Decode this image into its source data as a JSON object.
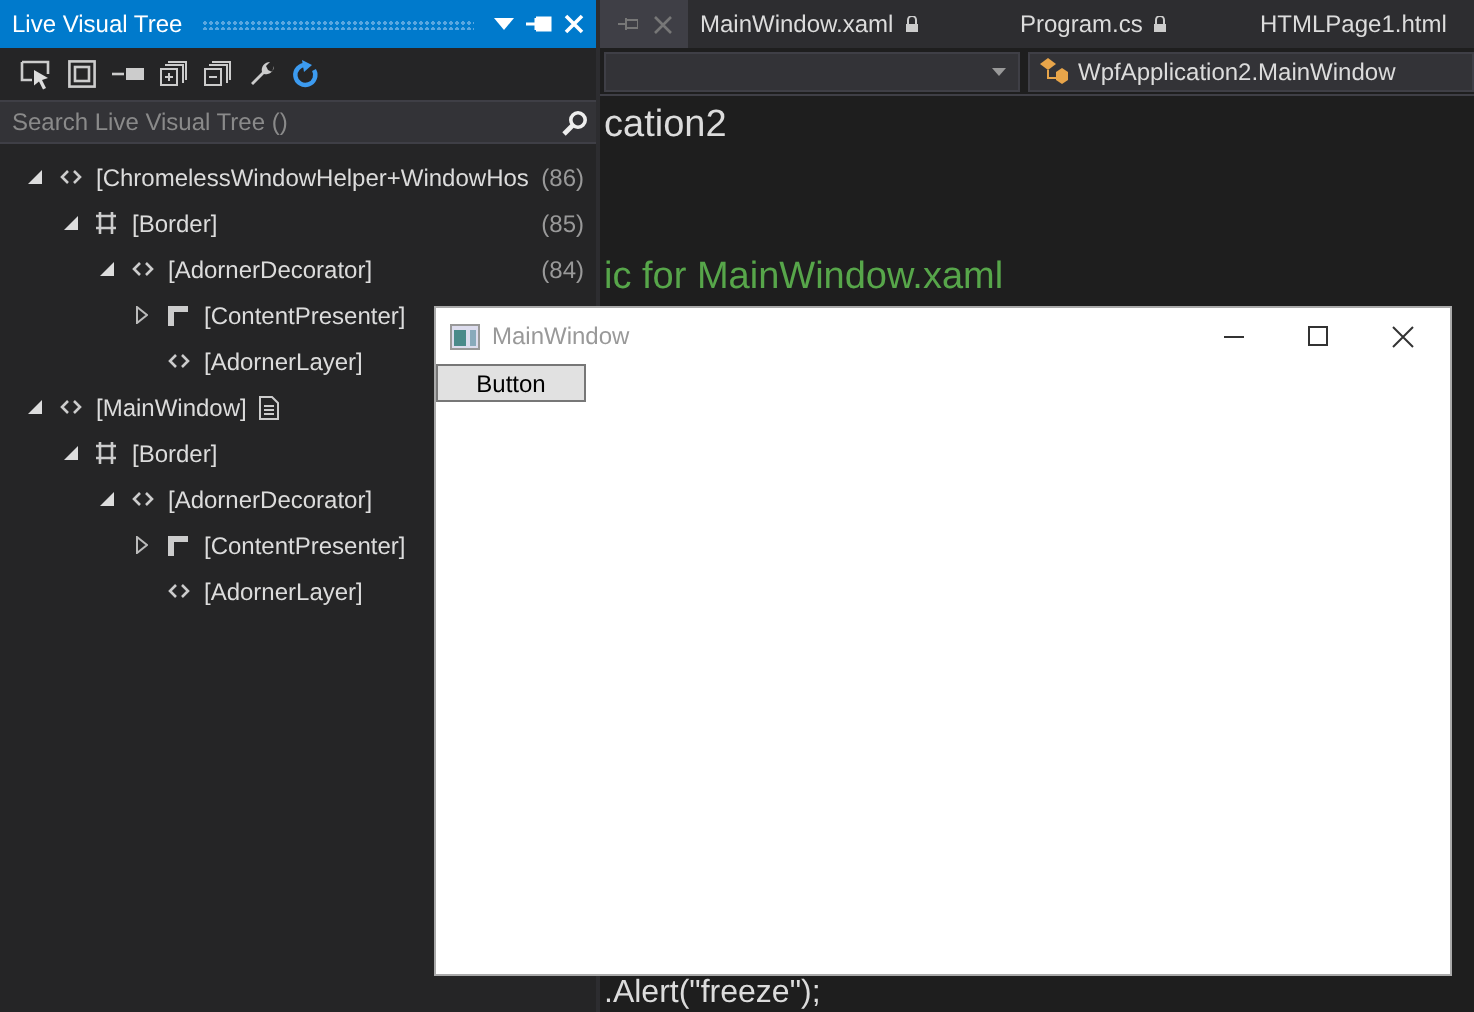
{
  "panel": {
    "title": "Live Visual Tree",
    "search": {
      "placeholder": "Search Live Visual Tree ()"
    },
    "tree": [
      {
        "label": "[ChromelessWindowHelper+WindowHos",
        "count": "(86)",
        "kind": "element",
        "expanded": true,
        "children": [
          {
            "label": "[Border]",
            "count": "(85)",
            "kind": "border",
            "expanded": true,
            "children": [
              {
                "label": "[AdornerDecorator]",
                "count": "(84)",
                "kind": "element",
                "expanded": true,
                "children": [
                  {
                    "label": "[ContentPresenter]",
                    "kind": "presenter",
                    "expanded": false
                  },
                  {
                    "label": "[AdornerLayer]",
                    "kind": "element"
                  }
                ]
              }
            ]
          }
        ]
      },
      {
        "label": "[MainWindow]",
        "kind": "element",
        "expanded": true,
        "properties_icon": true,
        "children": [
          {
            "label": "[Border]",
            "kind": "border",
            "expanded": true,
            "children": [
              {
                "label": "[AdornerDecorator]",
                "kind": "element",
                "expanded": true,
                "children": [
                  {
                    "label": "[ContentPresenter]",
                    "kind": "presenter",
                    "expanded": false
                  },
                  {
                    "label": "[AdornerLayer]",
                    "kind": "element"
                  }
                ]
              }
            ]
          }
        ]
      }
    ]
  },
  "editor": {
    "tabs": [
      {
        "label": "MainWindow.xaml",
        "locked": true,
        "selected": false
      },
      {
        "label": "Program.cs",
        "locked": true,
        "selected": false
      },
      {
        "label": "HTMLPage1.html",
        "locked": false,
        "selected": false
      }
    ],
    "class_dropdown": "WpfApplication2.MainWindow",
    "code_top": [
      {
        "text": "cation2",
        "kind": "code"
      },
      {
        "text": "ic for MainWindow.xaml",
        "kind": "comment"
      }
    ],
    "code_bottom": [
      {
        "text": ".Alert(\"freeze\");",
        "kind": "code"
      }
    ]
  },
  "window": {
    "title": "MainWindow",
    "button": "Button"
  }
}
